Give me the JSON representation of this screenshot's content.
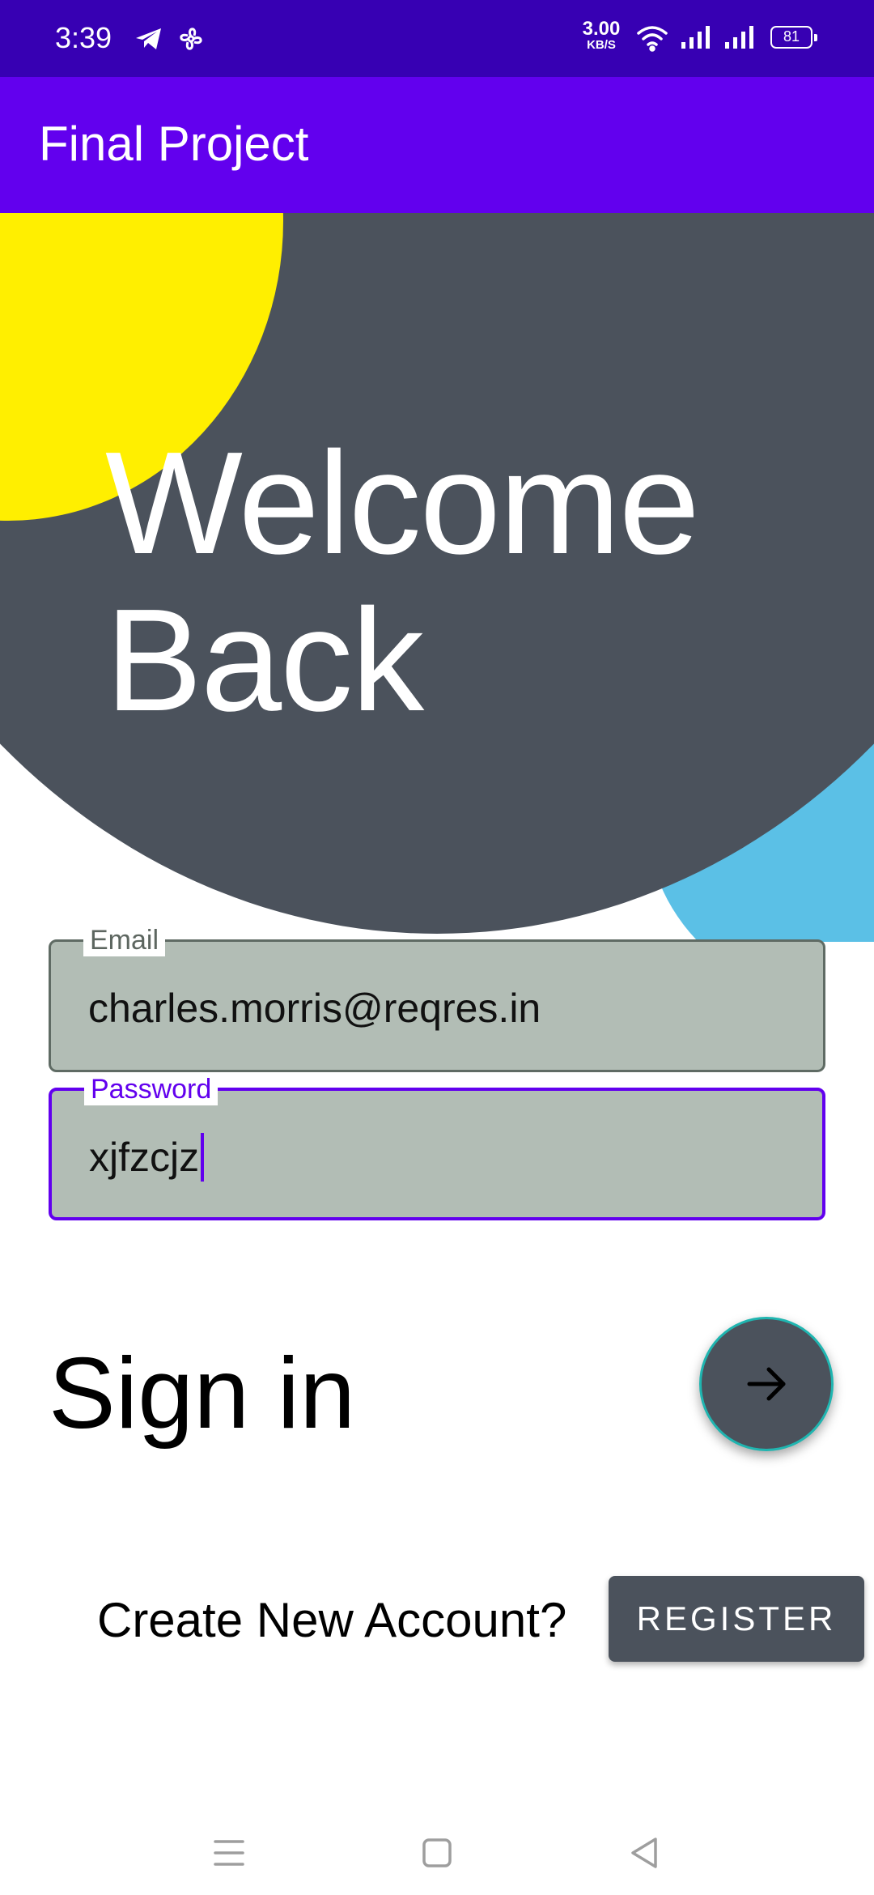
{
  "status_bar": {
    "time": "3:39",
    "net_speed_value": "3.00",
    "net_speed_unit": "KB/S",
    "battery": "81",
    "icons": [
      "telegram-icon",
      "pinwheel-icon",
      "wifi-icon",
      "signal-icon",
      "signal-icon",
      "battery-icon"
    ]
  },
  "app_bar": {
    "title": "Final Project",
    "color": "#6200EE"
  },
  "hero": {
    "line1": "Welcome",
    "line2": "Back",
    "colors": {
      "gray": "#4B525C",
      "yellow": "#FFEF00",
      "blue": "#5BC0E6"
    }
  },
  "form": {
    "email": {
      "label": "Email",
      "value": "charles.morris@reqres.in"
    },
    "password": {
      "label": "Password",
      "value": "xjfzcjz"
    }
  },
  "signin": {
    "title": "Sign in",
    "button_icon": "arrow-right-icon"
  },
  "register": {
    "prompt": "Create New Account?",
    "button_label": "REGISTER"
  },
  "nav": {
    "icons": [
      "menu-icon",
      "home-square-icon",
      "back-triangle-icon"
    ]
  }
}
